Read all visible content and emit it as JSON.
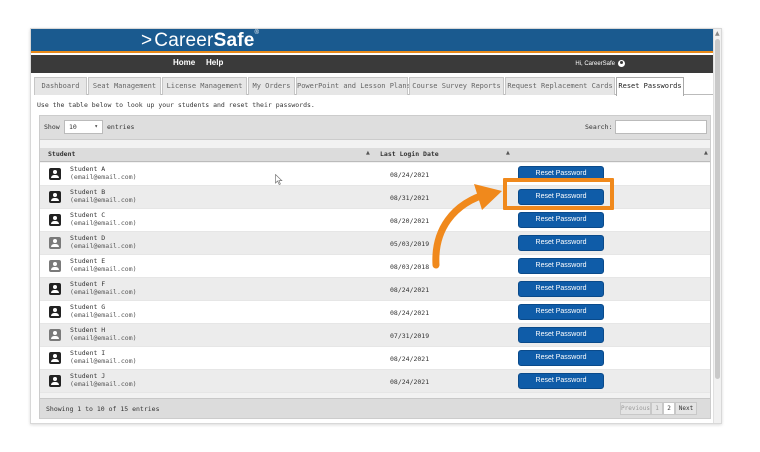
{
  "header": {
    "logo_career": "Career",
    "logo_safe": "Safe",
    "logo_chevron": ">",
    "logo_tm": "®",
    "nav_home": "Home",
    "nav_help": "Help",
    "greeting": "Hi, CareerSafe"
  },
  "tabs": [
    {
      "label": "Dashboard"
    },
    {
      "label": "Seat Management"
    },
    {
      "label": "License Management"
    },
    {
      "label": "My Orders"
    },
    {
      "label": "PowerPoint and Lesson Plans"
    },
    {
      "label": "Course Survey Reports"
    },
    {
      "label": "Request Replacement Cards"
    },
    {
      "label": "Reset Passwords"
    }
  ],
  "intro_text": "Use the table below to look up your students and reset their passwords.",
  "controls": {
    "show_label": "Show",
    "entries_value": "10",
    "entries_label": "entries",
    "search_label": "Search:",
    "search_value": ""
  },
  "table": {
    "col_student": "Student",
    "col_last_login": "Last Login Date",
    "rows": [
      {
        "name": "Student A",
        "email": "(email@email.com)",
        "login": "08/24/2021",
        "button": "Reset Password"
      },
      {
        "name": "Student B",
        "email": "(email@email.com)",
        "login": "08/31/2021",
        "button": "Reset Password"
      },
      {
        "name": "Student C",
        "email": "(email@email.com)",
        "login": "08/20/2021",
        "button": "Reset Password"
      },
      {
        "name": "Student D",
        "email": "(email@email.com)",
        "login": "05/03/2019",
        "button": "Reset Password"
      },
      {
        "name": "Student E",
        "email": "(email@email.com)",
        "login": "08/03/2018",
        "button": "Reset Password"
      },
      {
        "name": "Student F",
        "email": "(email@email.com)",
        "login": "08/24/2021",
        "button": "Reset Password"
      },
      {
        "name": "Student G",
        "email": "(email@email.com)",
        "login": "08/24/2021",
        "button": "Reset Password"
      },
      {
        "name": "Student H",
        "email": "(email@email.com)",
        "login": "07/31/2019",
        "button": "Reset Password"
      },
      {
        "name": "Student I",
        "email": "(email@email.com)",
        "login": "08/24/2021",
        "button": "Reset Password"
      },
      {
        "name": "Student J",
        "email": "(email@email.com)",
        "login": "08/24/2021",
        "button": "Reset Password"
      }
    ]
  },
  "footer": {
    "showing": "Showing 1 to 10 of 15 entries",
    "previous": "Previous",
    "page1": "1",
    "page2": "2",
    "next": "Next"
  },
  "colors": {
    "brand_blue": "#1a5a8f",
    "button_blue": "#0f5ca8",
    "accent_orange": "#f0891c",
    "nav_dark": "#3a3a3a"
  },
  "icons": [
    "user-circle-icon",
    "student-avatar-icon",
    "sort-caret-icon",
    "curved-arrow-annotation",
    "highlight-box-annotation",
    "mouse-cursor-icon"
  ]
}
